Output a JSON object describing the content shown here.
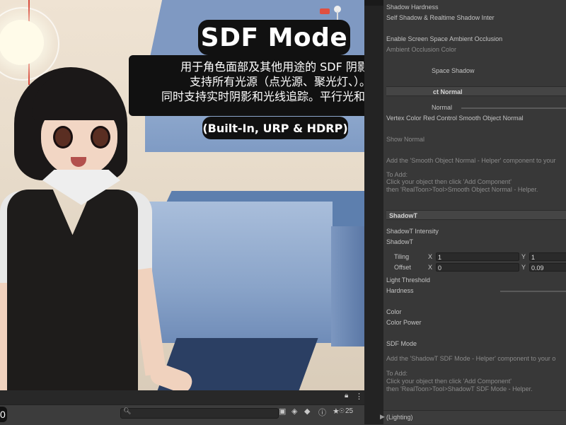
{
  "overlay": {
    "title": "SDF Mode",
    "desc_line1": "用于角色面部及其他用途的 SDF 阴影。",
    "desc_line2": "支持所有光源（点光源、聚光灯、）。",
    "desc_line3": "同时支持实时阴影和光线追踪。平行光和面光源",
    "pipelines": "(Built-In, URP & HDRP)"
  },
  "scene_bar": {
    "corner_label": "0",
    "search_placeholder": "",
    "count": "25",
    "icons": [
      "search-icon",
      "scene-visibility-icon",
      "layers-icon",
      "tag-icon",
      "info-icon",
      "star-icon",
      "eye-icon",
      "lock-icon",
      "more-icon"
    ]
  },
  "inspector": {
    "shadow_hardness": "Shadow Hardness",
    "self_shadow": "Self Shadow & Realtime Shadow Inter",
    "ssao": "Enable Screen Space Ambient Occlusion",
    "ao_color": "Ambient Occlusion Color",
    "space_shadow": "Space Shadow",
    "ct_normal": "ct Normal",
    "normal_label": "Normal",
    "vertex_color": "Vertex Color Red Control Smooth Object Normal",
    "show_normal": "Show Normal",
    "helper1_line1": "Add the 'Smooth Object Normal - Helper' component to your",
    "helper1_line2": "To Add:",
    "helper1_line3": "Click your object then click 'Add Component'",
    "helper1_line4": "then 'RealToon>Tool>Smooth Object Normal - Helper.",
    "shadowt_section": "ShadowT",
    "shadowt_intensity": "ShadowT Intensity",
    "shadowt": "ShadowT",
    "tiling": "Tiling",
    "offset": "Offset",
    "x_label": "X",
    "y_label": "Y",
    "tiling_x": "1",
    "tiling_y": "1",
    "offset_x": "0",
    "offset_y": "0.09",
    "light_threshold": "Light Threshold",
    "hardness": "Hardness",
    "color": "Color",
    "color_power": "Color Power",
    "sdf_mode": "SDF Mode",
    "helper2_line1": "Add the 'ShadowT SDF Mode - Helper' component to your o",
    "helper2_line2": "To Add:",
    "helper2_line3": "Click your object then click 'Add Component'",
    "helper2_line4": "then 'RealToon>Tool>ShadowT SDF Mode - Helper.",
    "lighting": "(Lighting)"
  }
}
